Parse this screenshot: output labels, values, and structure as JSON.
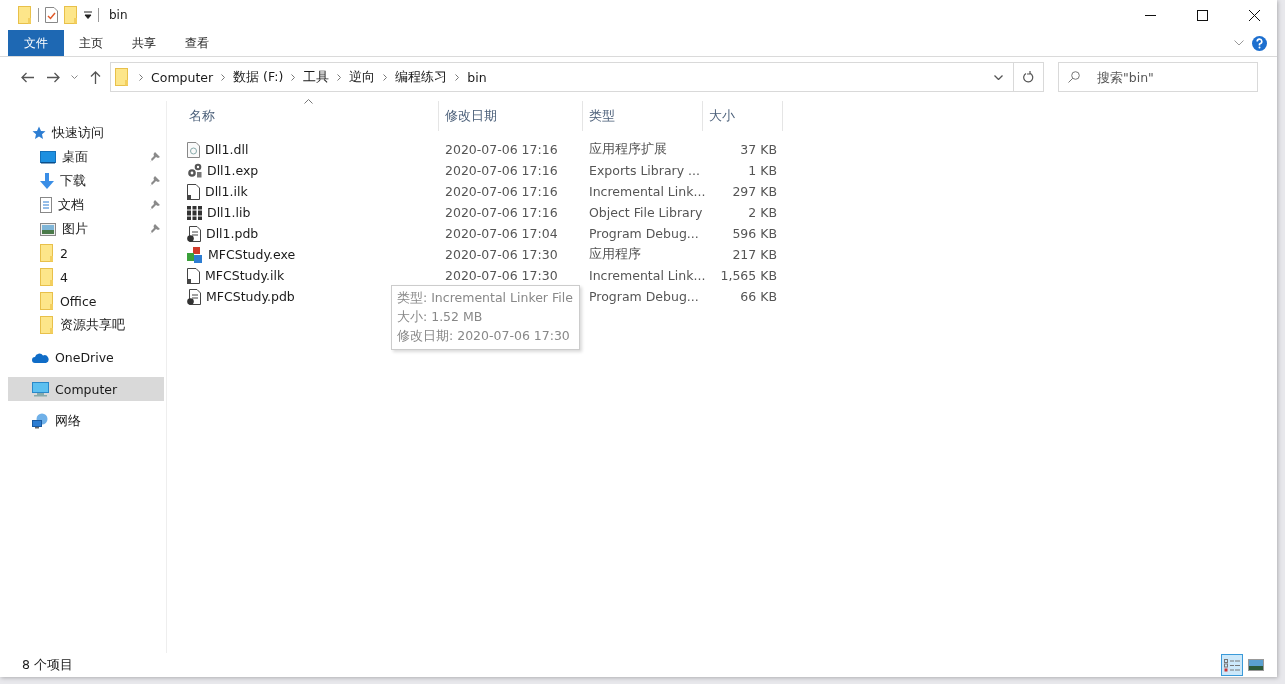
{
  "window": {
    "title": "bin"
  },
  "ribbon_tabs": [
    {
      "label": "文件",
      "kind": "file"
    },
    {
      "label": "主页",
      "kind": "tab"
    },
    {
      "label": "共享",
      "kind": "tab"
    },
    {
      "label": "查看",
      "kind": "tab"
    }
  ],
  "breadcrumb": [
    "Computer",
    "数据 (F:)",
    "工具",
    "逆向",
    "编程练习",
    "bin"
  ],
  "search": {
    "placeholder": "搜索\"bin\""
  },
  "sidebar": [
    {
      "label": "快速访问",
      "kind": "star",
      "selected": false,
      "children": [
        {
          "label": "桌面",
          "kind": "desktop",
          "pinned": true,
          "selected": false
        },
        {
          "label": "下载",
          "kind": "download",
          "pinned": true,
          "selected": false
        },
        {
          "label": "文档",
          "kind": "document",
          "pinned": true,
          "selected": false
        },
        {
          "label": "图片",
          "kind": "picture",
          "pinned": true,
          "selected": false
        },
        {
          "label": "2",
          "kind": "folder",
          "pinned": false,
          "selected": false
        },
        {
          "label": "4",
          "kind": "folder",
          "pinned": false,
          "selected": false
        },
        {
          "label": "Office",
          "kind": "folder",
          "pinned": false,
          "selected": false
        },
        {
          "label": "资源共享吧",
          "kind": "folder",
          "pinned": false,
          "selected": false
        }
      ]
    },
    {
      "label": "OneDrive",
      "kind": "cloud",
      "selected": false
    },
    {
      "label": "Computer",
      "kind": "computer",
      "selected": true
    },
    {
      "label": "网络",
      "kind": "network",
      "selected": false
    }
  ],
  "table": {
    "columns": [
      "名称",
      "修改日期",
      "类型",
      "大小"
    ],
    "rows": [
      {
        "name": "Dll1.dll",
        "kind": "dll",
        "date": "2020-07-06 17:16",
        "type": "应用程序扩展",
        "size": "37 KB"
      },
      {
        "name": "Dll1.exp",
        "kind": "exp",
        "date": "2020-07-06 17:16",
        "type": "Exports Library ...",
        "size": "1 KB"
      },
      {
        "name": "Dll1.ilk",
        "kind": "ilk",
        "date": "2020-07-06 17:16",
        "type": "Incremental Link...",
        "size": "297 KB"
      },
      {
        "name": "Dll1.lib",
        "kind": "lib",
        "date": "2020-07-06 17:16",
        "type": "Object File Library",
        "size": "2 KB"
      },
      {
        "name": "Dll1.pdb",
        "kind": "pdb",
        "date": "2020-07-06 17:04",
        "type": "Program Debug...",
        "size": "596 KB"
      },
      {
        "name": "MFCStudy.exe",
        "kind": "exe",
        "date": "2020-07-06 17:30",
        "type": "应用程序",
        "size": "217 KB"
      },
      {
        "name": "MFCStudy.ilk",
        "kind": "ilk",
        "date": "2020-07-06 17:30",
        "type": "Incremental Link...",
        "size": "1,565 KB"
      },
      {
        "name": "MFCStudy.pdb",
        "kind": "pdb",
        "type": "Program Debug...",
        "size": "66 KB"
      }
    ]
  },
  "tooltip": [
    "类型: Incremental Linker File",
    "大小: 1.52 MB",
    "修改日期: 2020-07-06 17:30"
  ],
  "status_bar": {
    "count": "8 个项目",
    "views": [
      {
        "kind": "details",
        "selected": true
      },
      {
        "kind": "large-icons",
        "selected": false
      }
    ]
  }
}
